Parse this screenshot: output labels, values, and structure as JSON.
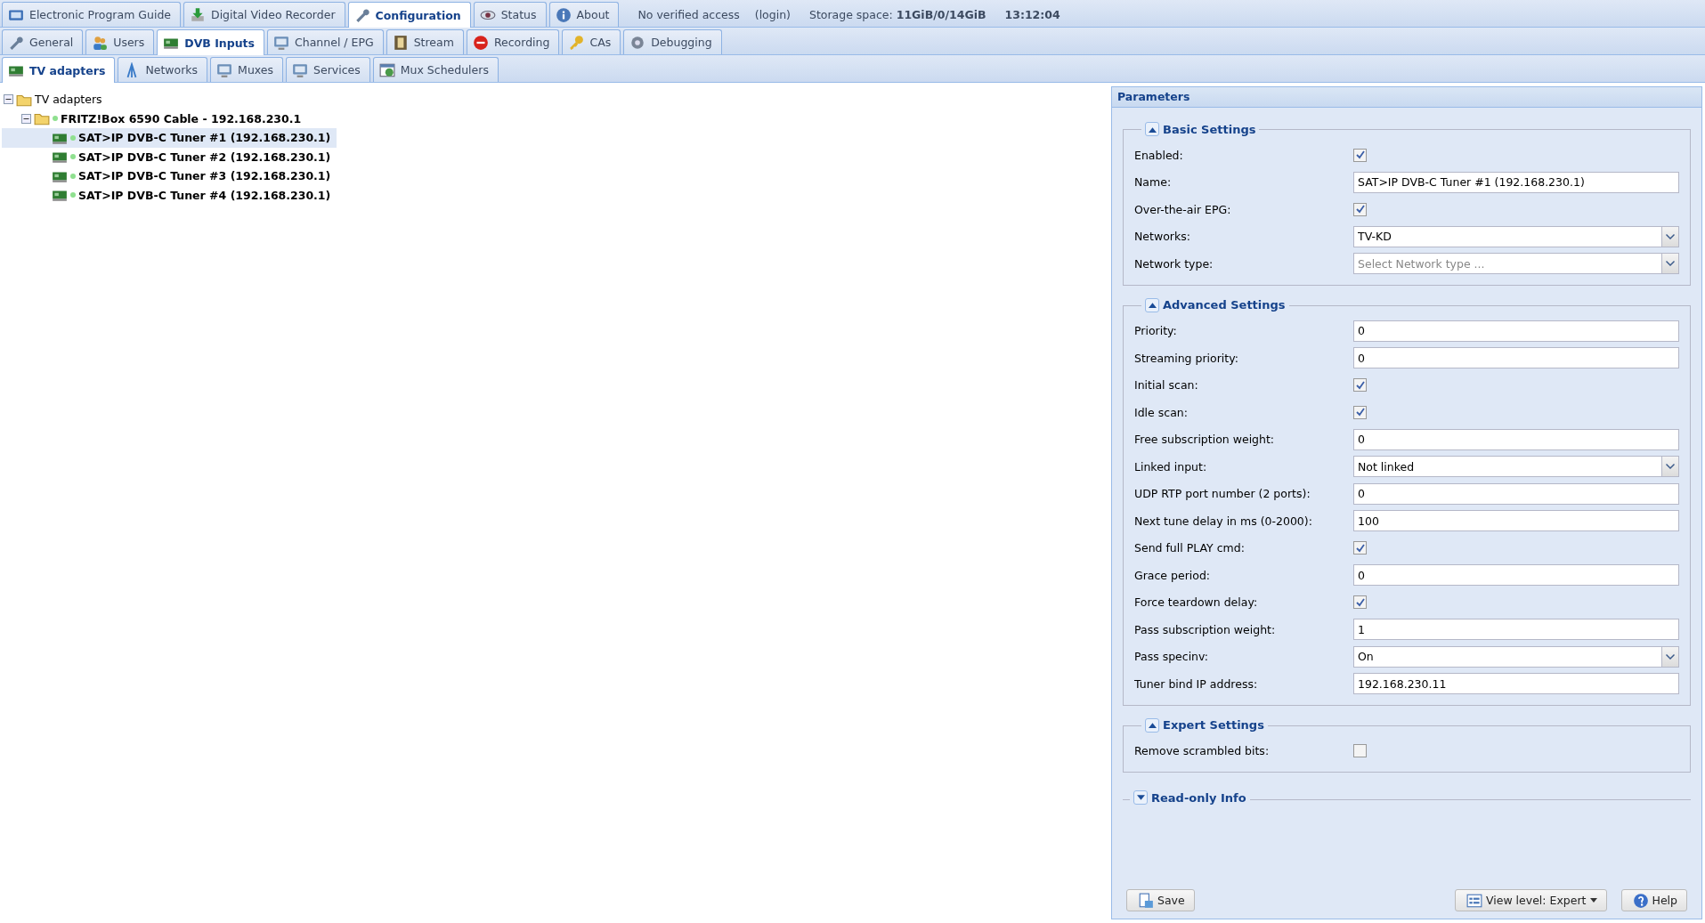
{
  "top_tabs": [
    {
      "label": "Electronic Program Guide",
      "selected": false
    },
    {
      "label": "Digital Video Recorder",
      "selected": false
    },
    {
      "label": "Configuration",
      "selected": true
    },
    {
      "label": "Status",
      "selected": false
    },
    {
      "label": "About",
      "selected": false
    }
  ],
  "status": {
    "access": "No verified access",
    "login": "(login)",
    "storage": "Storage space: **11GiB/0/14GiB**",
    "time": "13:12:04"
  },
  "config_tabs": [
    {
      "label": "General",
      "selected": false
    },
    {
      "label": "Users",
      "selected": false
    },
    {
      "label": "DVB Inputs",
      "selected": true
    },
    {
      "label": "Channel / EPG",
      "selected": false
    },
    {
      "label": "Stream",
      "selected": false
    },
    {
      "label": "Recording",
      "selected": false
    },
    {
      "label": "CAs",
      "selected": false
    },
    {
      "label": "Debugging",
      "selected": false
    }
  ],
  "dvb_tabs": [
    {
      "label": "TV adapters",
      "selected": true
    },
    {
      "label": "Networks",
      "selected": false
    },
    {
      "label": "Muxes",
      "selected": false
    },
    {
      "label": "Services",
      "selected": false
    },
    {
      "label": "Mux Schedulers",
      "selected": false
    }
  ],
  "tree": {
    "label": "TV adapters",
    "expanded": true,
    "children": [
      {
        "label": "FRITZ!Box 6590 Cable - 192.168.230.1",
        "expanded": true,
        "children": [
          {
            "label": "SAT>IP DVB-C Tuner #1 (192.168.230.1)",
            "selected": true
          },
          {
            "label": "SAT>IP DVB-C Tuner #2 (192.168.230.1)",
            "selected": false
          },
          {
            "label": "SAT>IP DVB-C Tuner #3 (192.168.230.1)",
            "selected": false
          },
          {
            "label": "SAT>IP DVB-C Tuner #4 (192.168.230.1)",
            "selected": false
          }
        ]
      }
    ]
  },
  "parameters": {
    "title": "Parameters",
    "sections": [
      {
        "title": "Basic Settings",
        "expanded": true,
        "fields": [
          {
            "kind": "checkbox",
            "label": "Enabled:",
            "checked": true
          },
          {
            "kind": "text",
            "label": "Name:",
            "value": "SAT>IP DVB-C Tuner #1 (192.168.230.1)"
          },
          {
            "kind": "checkbox",
            "label": "Over-the-air EPG:",
            "checked": true
          },
          {
            "kind": "combo",
            "label": "Networks:",
            "value": "TV-KD"
          },
          {
            "kind": "combo",
            "label": "Network type:",
            "placeholder": "Select Network type ..."
          }
        ]
      },
      {
        "title": "Advanced Settings",
        "expanded": true,
        "fields": [
          {
            "kind": "text",
            "label": "Priority:",
            "value": "0"
          },
          {
            "kind": "text",
            "label": "Streaming priority:",
            "value": "0"
          },
          {
            "kind": "checkbox",
            "label": "Initial scan:",
            "checked": true
          },
          {
            "kind": "checkbox",
            "label": "Idle scan:",
            "checked": true
          },
          {
            "kind": "text",
            "label": "Free subscription weight:",
            "value": "0"
          },
          {
            "kind": "combo",
            "label": "Linked input:",
            "value": "Not linked"
          },
          {
            "kind": "text",
            "label": "UDP RTP port number (2 ports):",
            "value": "0"
          },
          {
            "kind": "text",
            "label": "Next tune delay in ms (0-2000):",
            "value": "100"
          },
          {
            "kind": "checkbox",
            "label": "Send full PLAY cmd:",
            "checked": true
          },
          {
            "kind": "text",
            "label": "Grace period:",
            "value": "0"
          },
          {
            "kind": "checkbox",
            "label": "Force teardown delay:",
            "checked": true
          },
          {
            "kind": "text",
            "label": "Pass subscription weight:",
            "value": "1"
          },
          {
            "kind": "combo",
            "label": "Pass specinv:",
            "value": "On"
          },
          {
            "kind": "text",
            "label": "Tuner bind IP address:",
            "value": "192.168.230.11"
          }
        ]
      },
      {
        "title": "Expert Settings",
        "expanded": true,
        "fields": [
          {
            "kind": "checkbox",
            "label": "Remove scrambled bits:",
            "checked": false
          }
        ]
      },
      {
        "title": "Read-only Info",
        "expanded": false
      }
    ]
  },
  "buttons": {
    "save": "Save",
    "view_level": "View level: Expert",
    "help": "Help"
  }
}
